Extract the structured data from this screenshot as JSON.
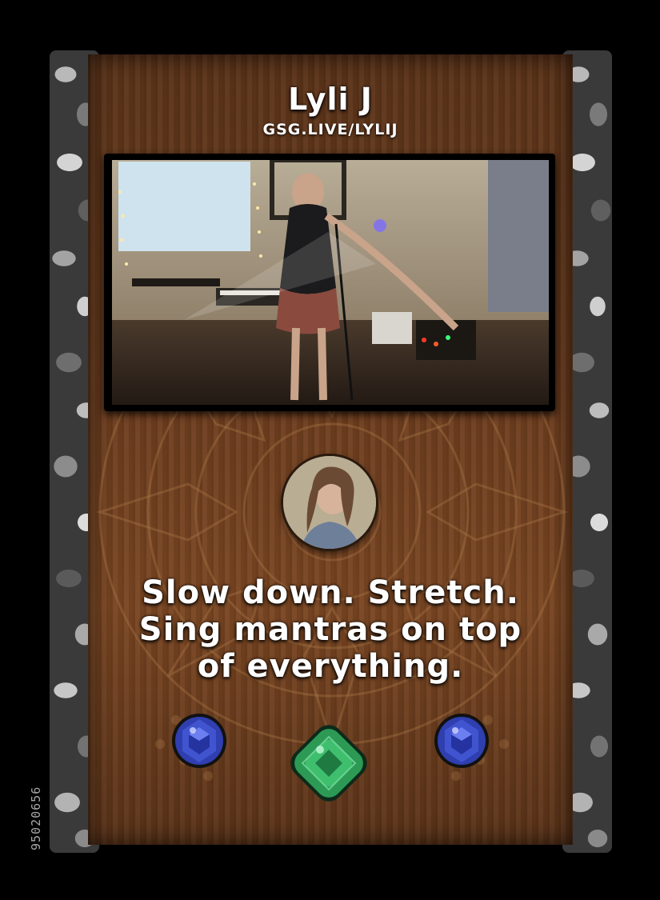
{
  "card": {
    "title": "Lyli J",
    "url": "GSG.LIVE/LYLIJ",
    "quote_lines": [
      "Slow down. Stretch.",
      "Sing mantras on top",
      "of everything."
    ],
    "serial": "95020656"
  },
  "gems": [
    "sapphire-gem",
    "emerald-gem",
    "sapphire-gem"
  ],
  "colors": {
    "wood": "#6b3c1e",
    "frame": "#000000",
    "text": "#ffffff",
    "sapphire": "#2f3fb0",
    "emerald": "#2c9a55"
  }
}
